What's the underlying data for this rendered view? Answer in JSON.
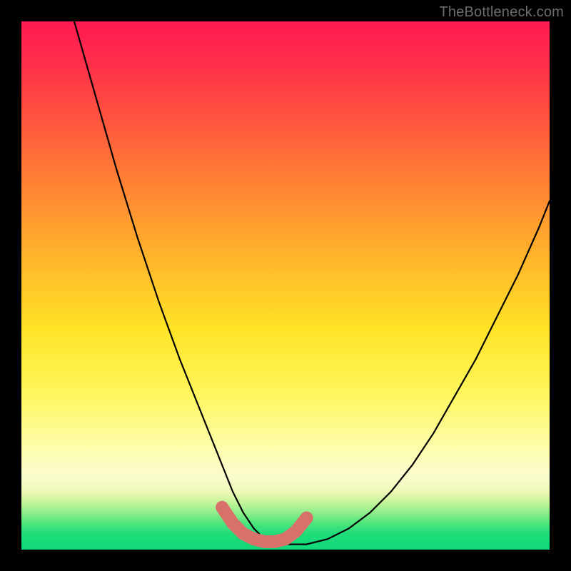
{
  "watermark": "TheBottleneck.com",
  "chart_data": {
    "type": "line",
    "title": "",
    "xlabel": "",
    "ylabel": "",
    "xlim": [
      0,
      100
    ],
    "ylim": [
      0,
      100
    ],
    "series": [
      {
        "name": "bottleneck-curve",
        "x": [
          10,
          14,
          18,
          22,
          26,
          30,
          34,
          38,
          40,
          42,
          44,
          46,
          48,
          50,
          54,
          58,
          62,
          66,
          70,
          74,
          78,
          82,
          86,
          90,
          94,
          98,
          100
        ],
        "y": [
          100,
          86,
          72,
          59,
          47,
          36,
          26,
          16,
          11,
          7,
          4,
          2,
          1,
          1,
          1,
          2,
          4,
          7,
          11,
          16,
          22,
          29,
          36,
          44,
          52,
          61,
          66
        ]
      }
    ],
    "highlight_segment": {
      "name": "optimal-range-marker",
      "color": "#d9716b",
      "x": [
        38,
        40,
        42,
        44,
        46,
        48,
        50,
        52,
        54
      ],
      "y": [
        8,
        5,
        3,
        2,
        1.5,
        1.5,
        2,
        3.5,
        6
      ]
    },
    "background_gradient": {
      "top": "#ff1a52",
      "mid": "#ffe326",
      "bottom": "#0fd87a"
    }
  }
}
